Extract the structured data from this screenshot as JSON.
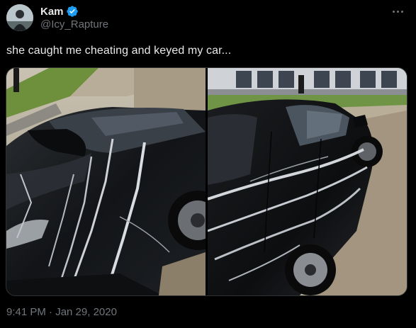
{
  "tweet": {
    "author": {
      "display_name": "Kam",
      "handle": "@Icy_Rapture",
      "verified": true,
      "avatar_icon": "avatar-image"
    },
    "text": "she caught me cheating and keyed my car...",
    "timestamp": "9:41 PM · Jan 29, 2020",
    "more_icon": "more-horizontal-icon",
    "media": [
      {
        "icon": "photo-car-keyed-front"
      },
      {
        "icon": "photo-car-keyed-side"
      }
    ]
  },
  "colors": {
    "background": "#000000",
    "primary_text": "#e7e9ea",
    "secondary_text": "#71767b",
    "verified_badge": "#1d9bf0",
    "border": "#2f3336"
  }
}
